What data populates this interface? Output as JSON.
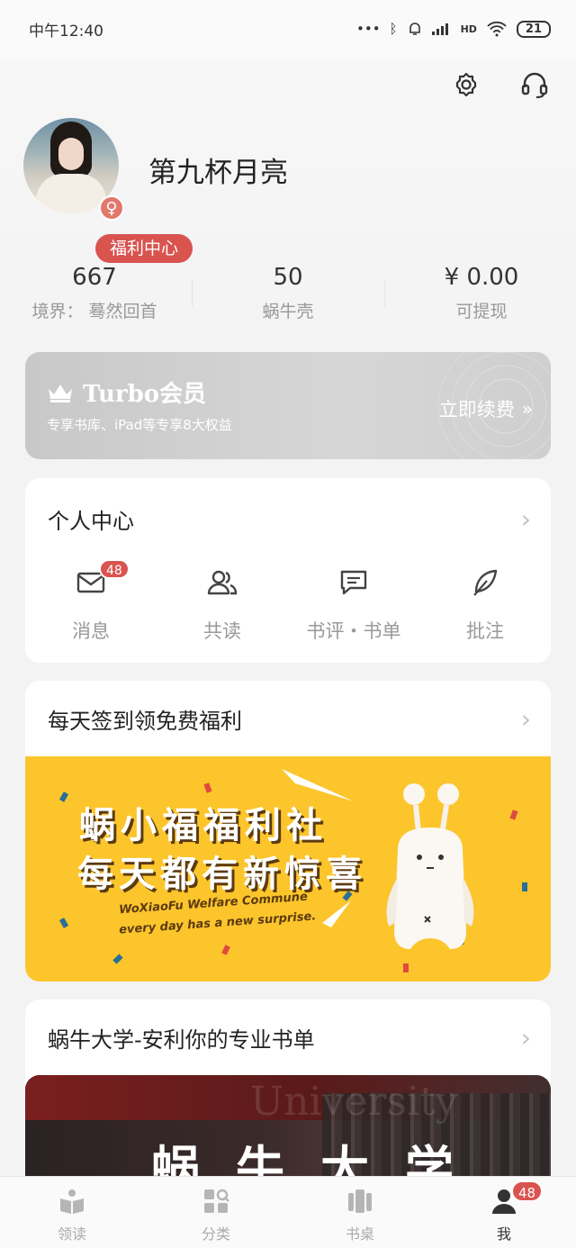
{
  "status_bar": {
    "time": "中午12:40",
    "signal_text": "HD",
    "battery": "21"
  },
  "profile": {
    "name": "第九杯月亮",
    "gender_symbol": "♀",
    "welfare_tag": "福利中心"
  },
  "stats": [
    {
      "value": "667",
      "label": "境界： 蓦然回首"
    },
    {
      "value": "50",
      "label": "蜗牛壳"
    },
    {
      "value": "¥ 0.00",
      "label": "可提现"
    }
  ],
  "turbo": {
    "title": "Turbo会员",
    "subtitle": "专享书库、iPad等专享8大权益",
    "renew": "立即续费"
  },
  "personal_center": {
    "title": "个人中心",
    "items": [
      {
        "label": "消息",
        "icon": "mail-icon",
        "badge": "48"
      },
      {
        "label": "共读",
        "icon": "users-icon"
      },
      {
        "label": "书评・书单",
        "icon": "comment-icon"
      },
      {
        "label": "批注",
        "icon": "feather-icon"
      }
    ]
  },
  "checkin": {
    "title": "每天签到领免费福利",
    "banner": {
      "line1": "蜗小福福利社",
      "line2": "每天都有新惊喜",
      "en1": "WoXiaoFu Welfare Commune",
      "en2": "every day has a new surprise."
    }
  },
  "university": {
    "title": "蜗牛大学-安利你的专业书单",
    "banner_text": "蜗牛大学",
    "ghost_text": "University"
  },
  "tab_bar": {
    "tabs": [
      {
        "label": "领读",
        "icon": "book-open-icon"
      },
      {
        "label": "分类",
        "icon": "category-grid-icon"
      },
      {
        "label": "书桌",
        "icon": "bookshelf-icon"
      },
      {
        "label": "我",
        "icon": "person-icon",
        "badge": "48",
        "active": true
      }
    ]
  },
  "colors": {
    "accent_red": "#d9534f",
    "banner_yellow": "#fcc52c",
    "turbo_gray": "#cfcfcf"
  }
}
